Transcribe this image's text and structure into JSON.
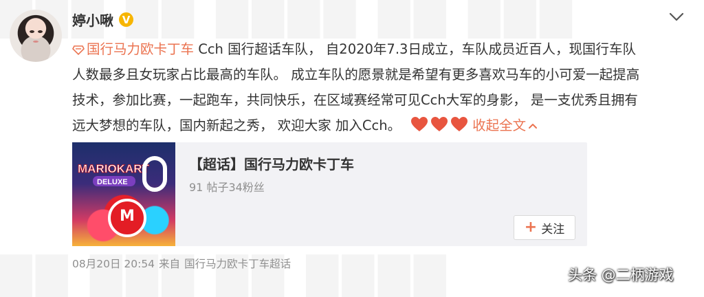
{
  "post": {
    "username": "婷小啾",
    "verified_badge": "V",
    "content": {
      "topic_link": "国行马力欧卡丁车",
      "line1_rest": " Cch 国行超话车队， 自2020年7.3日成立，车队成员近百人，现国行车队",
      "line2": "人数最多且女玩家占比最高的车队。 成立车队的愿景就是希望有更多喜欢马车的小可爱一起提高",
      "line3": "技术，参加比赛，一起跑车，共同快乐，在区域赛经常可见Cch大军的身影， 是一支优秀且拥有",
      "line4": "远大梦想的车队，国内新起之秀， 欢迎大家 加入Cch。",
      "heart_count": 3,
      "collapse_label": "收起全文"
    },
    "card": {
      "title": "【超话】国行马力欧卡丁车",
      "stats": "91 帖子34粉丝",
      "follow_label": "关注",
      "thumb_logo": "MARIOKART",
      "thumb_logo_sub": "DELUXE",
      "thumb_number": "8"
    },
    "meta": {
      "datetime": "08月20日 20:54",
      "source_prefix": "来自",
      "source": "国行马力欧卡丁车超话"
    },
    "watermark": "头条 @二柄游戏"
  },
  "colors": {
    "link": "#eb7350",
    "badge": "#f7b500",
    "heart": "#e8553f",
    "card_bg": "#f2f2f5",
    "meta_text": "#8f8f8f"
  },
  "icons": [
    "chevron-down-icon",
    "super-topic-diamond-icon",
    "heart-icon",
    "chevron-up-icon",
    "plus-icon"
  ]
}
